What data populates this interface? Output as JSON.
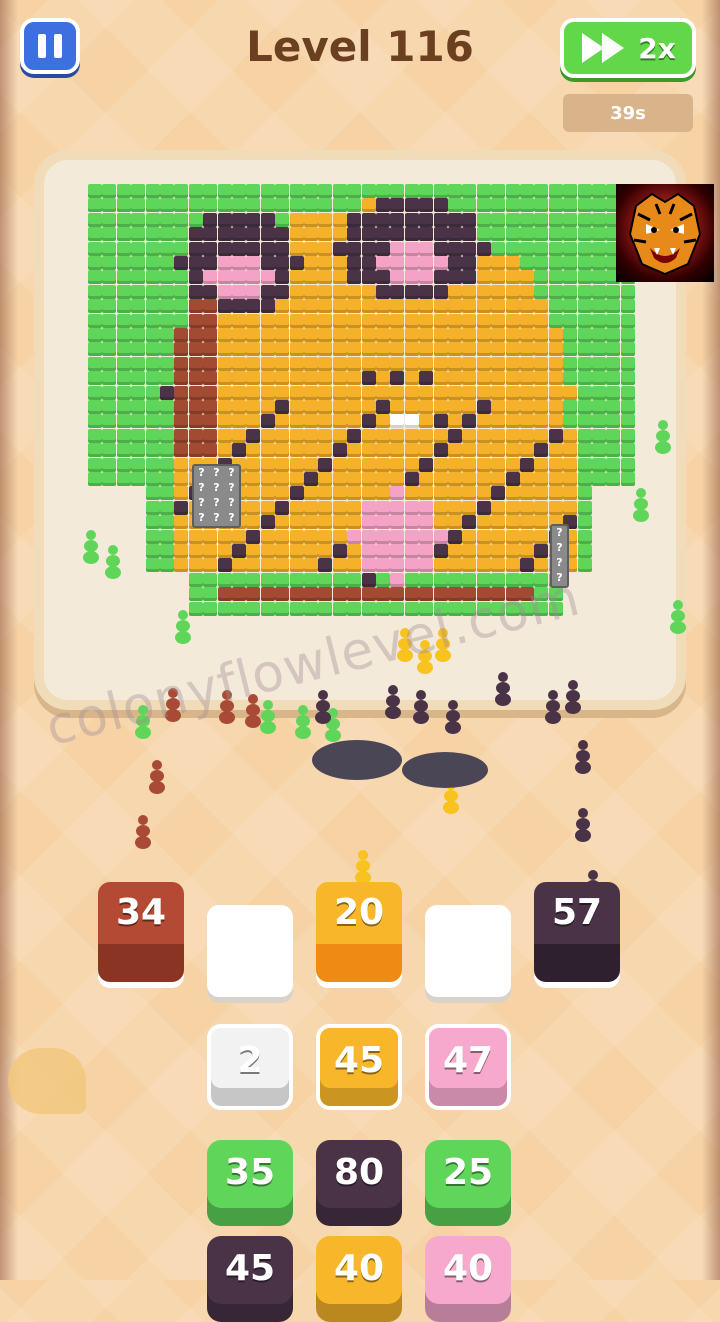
{
  "header": {
    "level_title": "Level 116",
    "speed_label": "2x",
    "timer": "39s"
  },
  "board": {
    "palette": {
      "G": "#5fd65a",
      "K": "#4a3347",
      "O": "#f5b12a",
      "P": "#f4a3c6",
      "B": "#a24a32",
      "W": "#ffffff",
      "M": "#8a8a8a"
    },
    "mystery_glyph": "?"
  },
  "watermark": "colonyflowlevel.com",
  "queue_slots": [
    {
      "value": "34",
      "color": "#b44a34",
      "dark": "#8a3524"
    },
    {
      "value": "",
      "color": "#ffffff",
      "dark": "#ffffff"
    },
    {
      "value": "20",
      "color": "#f8b62a",
      "dark": "#ef8a12"
    },
    {
      "value": "",
      "color": "#ffffff",
      "dark": "#ffffff"
    },
    {
      "value": "57",
      "color": "#4a3347",
      "dark": "#2f2030"
    }
  ],
  "tiles": [
    {
      "value": "2",
      "color": "#f2f2f2",
      "text": "#ffffff"
    },
    {
      "value": "45",
      "color": "#f8b62a",
      "text": "#ffffff"
    },
    {
      "value": "47",
      "color": "#f6a9cc",
      "text": "#ffffff"
    },
    {
      "value": "35",
      "color": "#5fd65a",
      "text": "#ffffff"
    },
    {
      "value": "80",
      "color": "#4a3347",
      "text": "#ffffff"
    },
    {
      "value": "25",
      "color": "#5fd65a",
      "text": "#ffffff"
    },
    {
      "value": "45",
      "color": "#4a3347",
      "text": "#ffffff"
    },
    {
      "value": "40",
      "color": "#f8b62a",
      "text": "#ffffff"
    },
    {
      "value": "40",
      "color": "#f6a9cc",
      "text": "#ffffff"
    }
  ],
  "ant_colors": {
    "green": "#5fd65a",
    "dark": "#4a3347",
    "yellow": "#f8c21f",
    "red": "#a84a36"
  },
  "icons": {
    "pause": "pause-icon",
    "speed": "fast-forward-icon",
    "logo": "tiger-logo"
  }
}
